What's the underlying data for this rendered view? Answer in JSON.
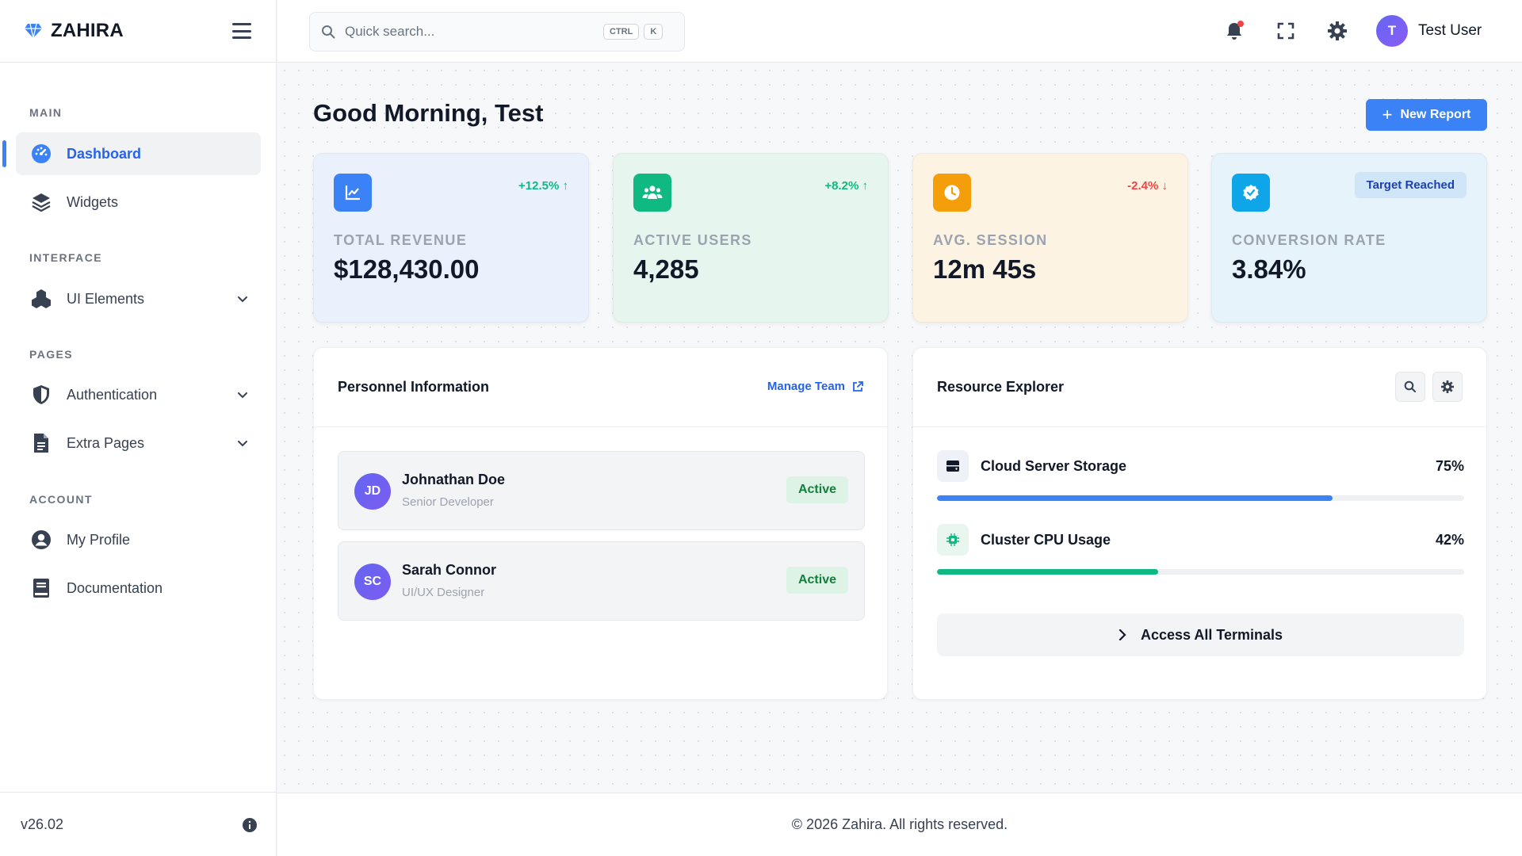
{
  "brand": {
    "name": "ZAHIRA",
    "accent": "#3b82f6"
  },
  "sidebar": {
    "sections": {
      "main": "MAIN",
      "interface": "INTERFACE",
      "pages": "PAGES",
      "account": "ACCOUNT"
    },
    "items": [
      {
        "label": "Dashboard",
        "icon": "dashboard-gauge-icon",
        "active": true
      },
      {
        "label": "Widgets",
        "icon": "layers-icon"
      },
      {
        "label": "UI Elements",
        "icon": "cubes-icon",
        "expandable": true
      },
      {
        "label": "Authentication",
        "icon": "shield-icon",
        "expandable": true
      },
      {
        "label": "Extra Pages",
        "icon": "file-icon",
        "expandable": true
      },
      {
        "label": "My Profile",
        "icon": "user-circle-icon"
      },
      {
        "label": "Documentation",
        "icon": "book-icon"
      }
    ],
    "version": "v26.02"
  },
  "topbar": {
    "search_placeholder": "Quick search...",
    "shortcut_ctrl": "CTRL",
    "shortcut_key": "K",
    "user_initial": "T",
    "user_name": "Test User"
  },
  "main": {
    "greeting": "Good Morning, Test",
    "new_report_label": "New Report"
  },
  "stats": [
    {
      "label": "TOTAL REVENUE",
      "value": "$128,430.00",
      "trend": "+12.5%",
      "direction": "up",
      "bg": "#eaf1fd",
      "icon_bg": "#3b82f6",
      "icon": "chart-line-icon"
    },
    {
      "label": "ACTIVE USERS",
      "value": "4,285",
      "trend": "+8.2%",
      "direction": "up",
      "bg": "#e6f6ef",
      "icon_bg": "#10b981",
      "icon": "users-icon"
    },
    {
      "label": "AVG. SESSION",
      "value": "12m 45s",
      "trend": "-2.4%",
      "direction": "down",
      "bg": "#fdf3e3",
      "icon_bg": "#f59e0b",
      "icon": "clock-icon"
    },
    {
      "label": "CONVERSION RATE",
      "value": "3.84%",
      "badge": "Target Reached",
      "bg": "#e7f3fb",
      "icon_bg": "#0ea5e9",
      "icon": "check-badge-icon"
    }
  ],
  "personnel": {
    "title": "Personnel Information",
    "manage_label": "Manage Team",
    "people": [
      {
        "initials": "JD",
        "name": "Johnathan Doe",
        "role": "Senior Developer",
        "status": "Active"
      },
      {
        "initials": "SC",
        "name": "Sarah Connor",
        "role": "UI/UX Designer",
        "status": "Active"
      }
    ]
  },
  "resources": {
    "title": "Resource Explorer",
    "items": [
      {
        "name": "Cloud Server Storage",
        "percent_label": "75%",
        "percent": 75,
        "color": "#3b82f6",
        "icon": "server-icon"
      },
      {
        "name": "Cluster CPU Usage",
        "percent_label": "42%",
        "percent": 42,
        "color": "#10b981",
        "icon": "cpu-chip-icon"
      }
    ],
    "action_label": "Access All Terminals"
  },
  "footer": {
    "copyright": "© 2026 Zahira. All rights reserved."
  }
}
